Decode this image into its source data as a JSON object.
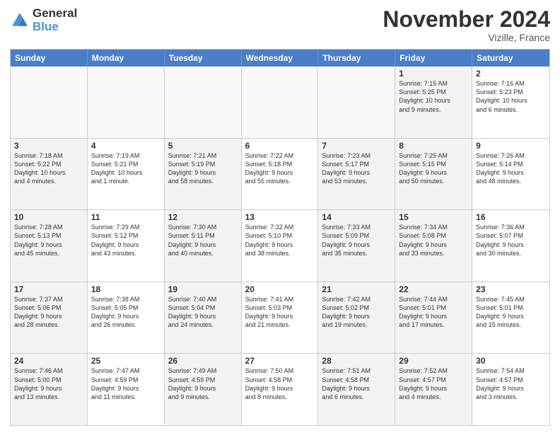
{
  "header": {
    "logo_line1": "General",
    "logo_line2": "Blue",
    "month_title": "November 2024",
    "location": "Vizille, France"
  },
  "weekdays": [
    "Sunday",
    "Monday",
    "Tuesday",
    "Wednesday",
    "Thursday",
    "Friday",
    "Saturday"
  ],
  "rows": [
    [
      {
        "day": "",
        "text": "",
        "empty": true
      },
      {
        "day": "",
        "text": "",
        "empty": true
      },
      {
        "day": "",
        "text": "",
        "empty": true
      },
      {
        "day": "",
        "text": "",
        "empty": true
      },
      {
        "day": "",
        "text": "",
        "empty": true
      },
      {
        "day": "1",
        "text": "Sunrise: 7:15 AM\nSunset: 5:25 PM\nDaylight: 10 hours\nand 9 minutes.",
        "shaded": true
      },
      {
        "day": "2",
        "text": "Sunrise: 7:16 AM\nSunset: 5:23 PM\nDaylight: 10 hours\nand 6 minutes."
      }
    ],
    [
      {
        "day": "3",
        "text": "Sunrise: 7:18 AM\nSunset: 5:22 PM\nDaylight: 10 hours\nand 4 minutes.",
        "shaded": true
      },
      {
        "day": "4",
        "text": "Sunrise: 7:19 AM\nSunset: 5:21 PM\nDaylight: 10 hours\nand 1 minute."
      },
      {
        "day": "5",
        "text": "Sunrise: 7:21 AM\nSunset: 5:19 PM\nDaylight: 9 hours\nand 58 minutes.",
        "shaded": true
      },
      {
        "day": "6",
        "text": "Sunrise: 7:22 AM\nSunset: 5:18 PM\nDaylight: 9 hours\nand 55 minutes."
      },
      {
        "day": "7",
        "text": "Sunrise: 7:23 AM\nSunset: 5:17 PM\nDaylight: 9 hours\nand 53 minutes.",
        "shaded": true
      },
      {
        "day": "8",
        "text": "Sunrise: 7:25 AM\nSunset: 5:15 PM\nDaylight: 9 hours\nand 50 minutes.",
        "shaded": true
      },
      {
        "day": "9",
        "text": "Sunrise: 7:26 AM\nSunset: 5:14 PM\nDaylight: 9 hours\nand 48 minutes."
      }
    ],
    [
      {
        "day": "10",
        "text": "Sunrise: 7:28 AM\nSunset: 5:13 PM\nDaylight: 9 hours\nand 45 minutes.",
        "shaded": true
      },
      {
        "day": "11",
        "text": "Sunrise: 7:29 AM\nSunset: 5:12 PM\nDaylight: 9 hours\nand 43 minutes."
      },
      {
        "day": "12",
        "text": "Sunrise: 7:30 AM\nSunset: 5:11 PM\nDaylight: 9 hours\nand 40 minutes.",
        "shaded": true
      },
      {
        "day": "13",
        "text": "Sunrise: 7:32 AM\nSunset: 5:10 PM\nDaylight: 9 hours\nand 38 minutes."
      },
      {
        "day": "14",
        "text": "Sunrise: 7:33 AM\nSunset: 5:09 PM\nDaylight: 9 hours\nand 35 minutes.",
        "shaded": true
      },
      {
        "day": "15",
        "text": "Sunrise: 7:34 AM\nSunset: 5:08 PM\nDaylight: 9 hours\nand 33 minutes.",
        "shaded": true
      },
      {
        "day": "16",
        "text": "Sunrise: 7:36 AM\nSunset: 5:07 PM\nDaylight: 9 hours\nand 30 minutes."
      }
    ],
    [
      {
        "day": "17",
        "text": "Sunrise: 7:37 AM\nSunset: 5:06 PM\nDaylight: 9 hours\nand 28 minutes.",
        "shaded": true
      },
      {
        "day": "18",
        "text": "Sunrise: 7:38 AM\nSunset: 5:05 PM\nDaylight: 9 hours\nand 26 minutes."
      },
      {
        "day": "19",
        "text": "Sunrise: 7:40 AM\nSunset: 5:04 PM\nDaylight: 9 hours\nand 24 minutes.",
        "shaded": true
      },
      {
        "day": "20",
        "text": "Sunrise: 7:41 AM\nSunset: 5:03 PM\nDaylight: 9 hours\nand 21 minutes."
      },
      {
        "day": "21",
        "text": "Sunrise: 7:42 AM\nSunset: 5:02 PM\nDaylight: 9 hours\nand 19 minutes.",
        "shaded": true
      },
      {
        "day": "22",
        "text": "Sunrise: 7:44 AM\nSunset: 5:01 PM\nDaylight: 9 hours\nand 17 minutes.",
        "shaded": true
      },
      {
        "day": "23",
        "text": "Sunrise: 7:45 AM\nSunset: 5:01 PM\nDaylight: 9 hours\nand 15 minutes."
      }
    ],
    [
      {
        "day": "24",
        "text": "Sunrise: 7:46 AM\nSunset: 5:00 PM\nDaylight: 9 hours\nand 13 minutes.",
        "shaded": true
      },
      {
        "day": "25",
        "text": "Sunrise: 7:47 AM\nSunset: 4:59 PM\nDaylight: 9 hours\nand 11 minutes."
      },
      {
        "day": "26",
        "text": "Sunrise: 7:49 AM\nSunset: 4:59 PM\nDaylight: 9 hours\nand 9 minutes.",
        "shaded": true
      },
      {
        "day": "27",
        "text": "Sunrise: 7:50 AM\nSunset: 4:58 PM\nDaylight: 9 hours\nand 8 minutes."
      },
      {
        "day": "28",
        "text": "Sunrise: 7:51 AM\nSunset: 4:58 PM\nDaylight: 9 hours\nand 6 minutes.",
        "shaded": true
      },
      {
        "day": "29",
        "text": "Sunrise: 7:52 AM\nSunset: 4:57 PM\nDaylight: 9 hours\nand 4 minutes.",
        "shaded": true
      },
      {
        "day": "30",
        "text": "Sunrise: 7:54 AM\nSunset: 4:57 PM\nDaylight: 9 hours\nand 3 minutes."
      }
    ]
  ]
}
